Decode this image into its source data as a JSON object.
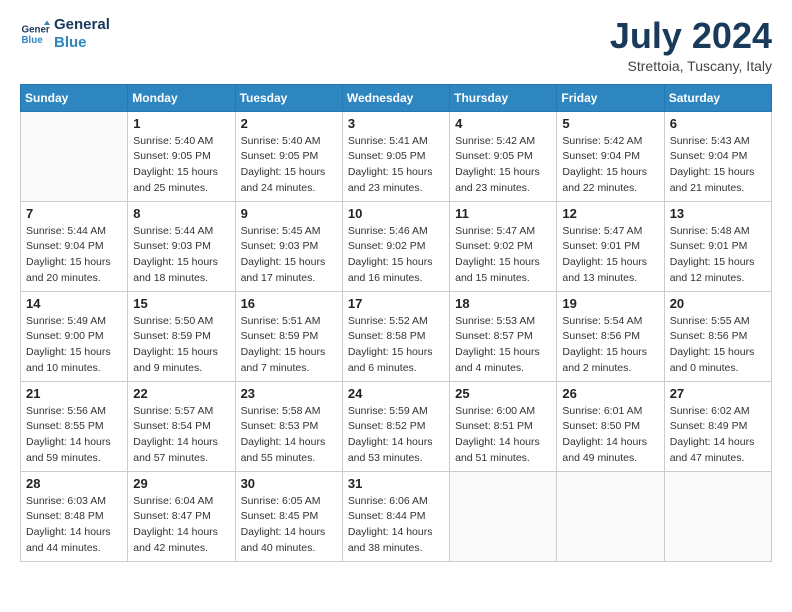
{
  "logo": {
    "line1": "General",
    "line2": "Blue"
  },
  "title": "July 2024",
  "location": "Strettoia, Tuscany, Italy",
  "days_of_week": [
    "Sunday",
    "Monday",
    "Tuesday",
    "Wednesday",
    "Thursday",
    "Friday",
    "Saturday"
  ],
  "weeks": [
    [
      {
        "day": "",
        "info": ""
      },
      {
        "day": "1",
        "info": "Sunrise: 5:40 AM\nSunset: 9:05 PM\nDaylight: 15 hours\nand 25 minutes."
      },
      {
        "day": "2",
        "info": "Sunrise: 5:40 AM\nSunset: 9:05 PM\nDaylight: 15 hours\nand 24 minutes."
      },
      {
        "day": "3",
        "info": "Sunrise: 5:41 AM\nSunset: 9:05 PM\nDaylight: 15 hours\nand 23 minutes."
      },
      {
        "day": "4",
        "info": "Sunrise: 5:42 AM\nSunset: 9:05 PM\nDaylight: 15 hours\nand 23 minutes."
      },
      {
        "day": "5",
        "info": "Sunrise: 5:42 AM\nSunset: 9:04 PM\nDaylight: 15 hours\nand 22 minutes."
      },
      {
        "day": "6",
        "info": "Sunrise: 5:43 AM\nSunset: 9:04 PM\nDaylight: 15 hours\nand 21 minutes."
      }
    ],
    [
      {
        "day": "7",
        "info": "Sunrise: 5:44 AM\nSunset: 9:04 PM\nDaylight: 15 hours\nand 20 minutes."
      },
      {
        "day": "8",
        "info": "Sunrise: 5:44 AM\nSunset: 9:03 PM\nDaylight: 15 hours\nand 18 minutes."
      },
      {
        "day": "9",
        "info": "Sunrise: 5:45 AM\nSunset: 9:03 PM\nDaylight: 15 hours\nand 17 minutes."
      },
      {
        "day": "10",
        "info": "Sunrise: 5:46 AM\nSunset: 9:02 PM\nDaylight: 15 hours\nand 16 minutes."
      },
      {
        "day": "11",
        "info": "Sunrise: 5:47 AM\nSunset: 9:02 PM\nDaylight: 15 hours\nand 15 minutes."
      },
      {
        "day": "12",
        "info": "Sunrise: 5:47 AM\nSunset: 9:01 PM\nDaylight: 15 hours\nand 13 minutes."
      },
      {
        "day": "13",
        "info": "Sunrise: 5:48 AM\nSunset: 9:01 PM\nDaylight: 15 hours\nand 12 minutes."
      }
    ],
    [
      {
        "day": "14",
        "info": "Sunrise: 5:49 AM\nSunset: 9:00 PM\nDaylight: 15 hours\nand 10 minutes."
      },
      {
        "day": "15",
        "info": "Sunrise: 5:50 AM\nSunset: 8:59 PM\nDaylight: 15 hours\nand 9 minutes."
      },
      {
        "day": "16",
        "info": "Sunrise: 5:51 AM\nSunset: 8:59 PM\nDaylight: 15 hours\nand 7 minutes."
      },
      {
        "day": "17",
        "info": "Sunrise: 5:52 AM\nSunset: 8:58 PM\nDaylight: 15 hours\nand 6 minutes."
      },
      {
        "day": "18",
        "info": "Sunrise: 5:53 AM\nSunset: 8:57 PM\nDaylight: 15 hours\nand 4 minutes."
      },
      {
        "day": "19",
        "info": "Sunrise: 5:54 AM\nSunset: 8:56 PM\nDaylight: 15 hours\nand 2 minutes."
      },
      {
        "day": "20",
        "info": "Sunrise: 5:55 AM\nSunset: 8:56 PM\nDaylight: 15 hours\nand 0 minutes."
      }
    ],
    [
      {
        "day": "21",
        "info": "Sunrise: 5:56 AM\nSunset: 8:55 PM\nDaylight: 14 hours\nand 59 minutes."
      },
      {
        "day": "22",
        "info": "Sunrise: 5:57 AM\nSunset: 8:54 PM\nDaylight: 14 hours\nand 57 minutes."
      },
      {
        "day": "23",
        "info": "Sunrise: 5:58 AM\nSunset: 8:53 PM\nDaylight: 14 hours\nand 55 minutes."
      },
      {
        "day": "24",
        "info": "Sunrise: 5:59 AM\nSunset: 8:52 PM\nDaylight: 14 hours\nand 53 minutes."
      },
      {
        "day": "25",
        "info": "Sunrise: 6:00 AM\nSunset: 8:51 PM\nDaylight: 14 hours\nand 51 minutes."
      },
      {
        "day": "26",
        "info": "Sunrise: 6:01 AM\nSunset: 8:50 PM\nDaylight: 14 hours\nand 49 minutes."
      },
      {
        "day": "27",
        "info": "Sunrise: 6:02 AM\nSunset: 8:49 PM\nDaylight: 14 hours\nand 47 minutes."
      }
    ],
    [
      {
        "day": "28",
        "info": "Sunrise: 6:03 AM\nSunset: 8:48 PM\nDaylight: 14 hours\nand 44 minutes."
      },
      {
        "day": "29",
        "info": "Sunrise: 6:04 AM\nSunset: 8:47 PM\nDaylight: 14 hours\nand 42 minutes."
      },
      {
        "day": "30",
        "info": "Sunrise: 6:05 AM\nSunset: 8:45 PM\nDaylight: 14 hours\nand 40 minutes."
      },
      {
        "day": "31",
        "info": "Sunrise: 6:06 AM\nSunset: 8:44 PM\nDaylight: 14 hours\nand 38 minutes."
      },
      {
        "day": "",
        "info": ""
      },
      {
        "day": "",
        "info": ""
      },
      {
        "day": "",
        "info": ""
      }
    ]
  ]
}
